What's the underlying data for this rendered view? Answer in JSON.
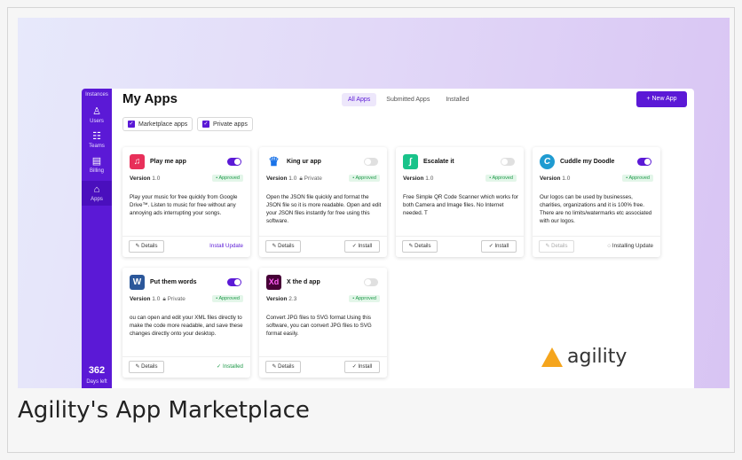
{
  "caption": "Agility's App Marketplace",
  "colors": {
    "accent": "#5b19d6",
    "approved": "#1f9a4a",
    "logo": "#f5a51d"
  },
  "sidebar": {
    "items": [
      {
        "label": "Instances",
        "icon": ""
      },
      {
        "label": "Users",
        "icon": "user-icon"
      },
      {
        "label": "Teams",
        "icon": "teams-icon"
      },
      {
        "label": "Billing",
        "icon": "billing-icon"
      },
      {
        "label": "Apps",
        "icon": "apps-icon"
      }
    ],
    "count": "362",
    "count_label": "Days left"
  },
  "header": {
    "title": "My Apps",
    "tabs": [
      "All Apps",
      "Submitted Apps",
      "Installed"
    ],
    "active_tab": "All Apps",
    "new_app": "+ New App"
  },
  "filters": [
    "Marketplace apps",
    "Private apps"
  ],
  "cards": [
    {
      "name": "Play me app",
      "icon_text": "♫",
      "icon_color": "#e8305a",
      "enabled": true,
      "version_label": "Version",
      "version": "1.0",
      "private": "",
      "status": "• Approved",
      "desc": "Play your music for free quickly from Google Drive™. Listen to music for free without any annoying ads interrupting your songs.",
      "details": "Details",
      "action": "Install Update",
      "action_type": "link"
    },
    {
      "name": "King ur app",
      "icon_text": "♛",
      "icon_color": "#1a73e8",
      "enabled": false,
      "version_label": "Version",
      "version": "1.0",
      "private": "Private",
      "status": "• Approved",
      "desc": "Open the JSON file quickly and format the JSON file so it is more readable. Open and edit your JSON files instantly for free using this software.",
      "details": "Details",
      "action": "Install",
      "action_type": "button"
    },
    {
      "name": "Escalate it",
      "icon_text": "∫",
      "icon_color": "#19c38a",
      "enabled": false,
      "version_label": "Version",
      "version": "1.0",
      "private": "",
      "status": "• Approved",
      "desc": "Free Simple QR Code Scanner which works for both Camera and Image files. No Internet needed. T",
      "details": "Details",
      "action": "Install",
      "action_type": "button"
    },
    {
      "name": "Cuddle my Doodle",
      "icon_text": "C",
      "icon_color": "#1f9bd1",
      "enabled": true,
      "version_label": "Version",
      "version": "1.0",
      "private": "",
      "status": "• Approved",
      "desc": "Our logos can be used by businesses, charities, organizations and it is 100% free. There are no limits/watermarks etc associated with our logos.",
      "details": "Details",
      "action": "Installing Update",
      "action_type": "installing"
    },
    {
      "name": "Put them words",
      "icon_text": "W",
      "icon_color": "#2b579a",
      "enabled": true,
      "version_label": "Version",
      "version": "1.0",
      "private": "Private",
      "status": "• Approved",
      "desc": "ou can open and edit your XML files directly to make the code more readable, and save these changes directly onto your desktop.",
      "details": "Details",
      "action": "Installed",
      "action_type": "installed"
    },
    {
      "name": "X the d app",
      "icon_text": "Xd",
      "icon_color": "#470137",
      "enabled": false,
      "version_label": "Version",
      "version": "2.3",
      "private": "",
      "status": "• Approved",
      "desc": "Convert JPG files to SVG format Using this software, you can convert JPG files to SVG format easily.",
      "details": "Details",
      "action": "Install",
      "action_type": "button"
    }
  ],
  "logo": {
    "text": "agility"
  }
}
